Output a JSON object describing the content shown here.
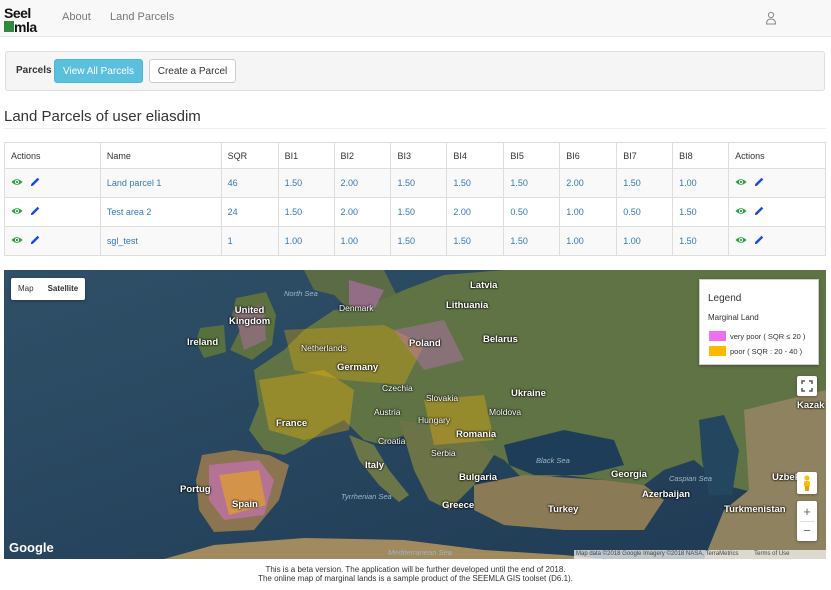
{
  "nav": {
    "logo_top": "Seel",
    "logo_bottom": "mla",
    "about": "About",
    "land_parcels": "Land Parcels",
    "user_icon": "user-icon"
  },
  "toolbar": {
    "label": "Parcels",
    "view_all": "View All Parcels",
    "create": "Create a Parcel"
  },
  "page_title": "Land Parcels of user eliasdim",
  "table": {
    "headers": [
      "Actions",
      "Name",
      "SQR",
      "BI1",
      "BI2",
      "BI3",
      "BI4",
      "BI5",
      "BI6",
      "BI7",
      "BI8",
      "Actions"
    ],
    "rows": [
      {
        "name": "Land parcel 1",
        "sqr": "46",
        "bi": [
          "1.50",
          "2.00",
          "1.50",
          "1.50",
          "1.50",
          "2.00",
          "1.50",
          "1.00"
        ]
      },
      {
        "name": "Test area 2",
        "sqr": "24",
        "bi": [
          "1.50",
          "2.00",
          "1.50",
          "2.00",
          "0.50",
          "1.00",
          "0.50",
          "1.50"
        ]
      },
      {
        "name": "sgl_test",
        "sqr": "1",
        "bi": [
          "1.00",
          "1.00",
          "1.50",
          "1.50",
          "1.50",
          "1.00",
          "1.00",
          "1.50"
        ]
      }
    ],
    "icons": {
      "view": "eye-icon",
      "edit": "pencil-icon"
    }
  },
  "map": {
    "type_map": "Map",
    "type_satellite": "Satellite",
    "labels": {
      "north_sea": "North Sea",
      "latvia": "Latvia",
      "denmark": "Denmark",
      "lithuania": "Lithuania",
      "united_kingdom": "United\nKingdom",
      "ireland": "Ireland",
      "netherlands": "Netherlands",
      "belarus": "Belarus",
      "poland": "Poland",
      "germany": "Germany",
      "czechia": "Czechia",
      "ukraine": "Ukraine",
      "slovakia": "Slovakia",
      "austria": "Austria",
      "moldova": "Moldova",
      "hungary": "Hungary",
      "france": "France",
      "croatia": "Croatia",
      "romania": "Romania",
      "serbia": "Serbia",
      "black_sea": "Black Sea",
      "italy": "Italy",
      "bulgaria": "Bulgaria",
      "georgia": "Georgia",
      "portugal": "Portug",
      "caspian_sea": "Caspian Sea",
      "azerbaijan": "Azerbaijan",
      "spain": "Spain",
      "tyrrhenian_sea": "Tyrrhenian Sea",
      "greece": "Greece",
      "turkey": "Turkey",
      "turkmenistan": "Turkmenistan",
      "uzbekistan": "Uzbek",
      "kazakhstan": "Kazak",
      "mediterranean_sea": "Mediterranean Sea"
    },
    "google": "Google",
    "attribution": "Map data ©2018 Google Imagery ©2018 NASA, TerraMetrics",
    "terms": "Terms of Use",
    "zoom_in": "+",
    "zoom_out": "−",
    "legend": {
      "title": "Legend",
      "subtitle": "Marginal Land",
      "items": [
        {
          "label": "very poor ( SQR ≤ 20 )",
          "color": "#ee6ff0"
        },
        {
          "label": "poor ( SQR : 20 - 40 )",
          "color": "#ffb800"
        }
      ]
    }
  },
  "footer": {
    "line1": "This is a beta version. The application will be further developed until the end of 2018.",
    "line2": "The online map of marginal lands is a sample product of the SEEMLA GIS toolset (D6.1)."
  },
  "colors": {
    "accent": "#5bc0de",
    "link": "#337ab7",
    "view_icon": "#2e9e3e",
    "edit_icon": "#1a4fd6"
  }
}
